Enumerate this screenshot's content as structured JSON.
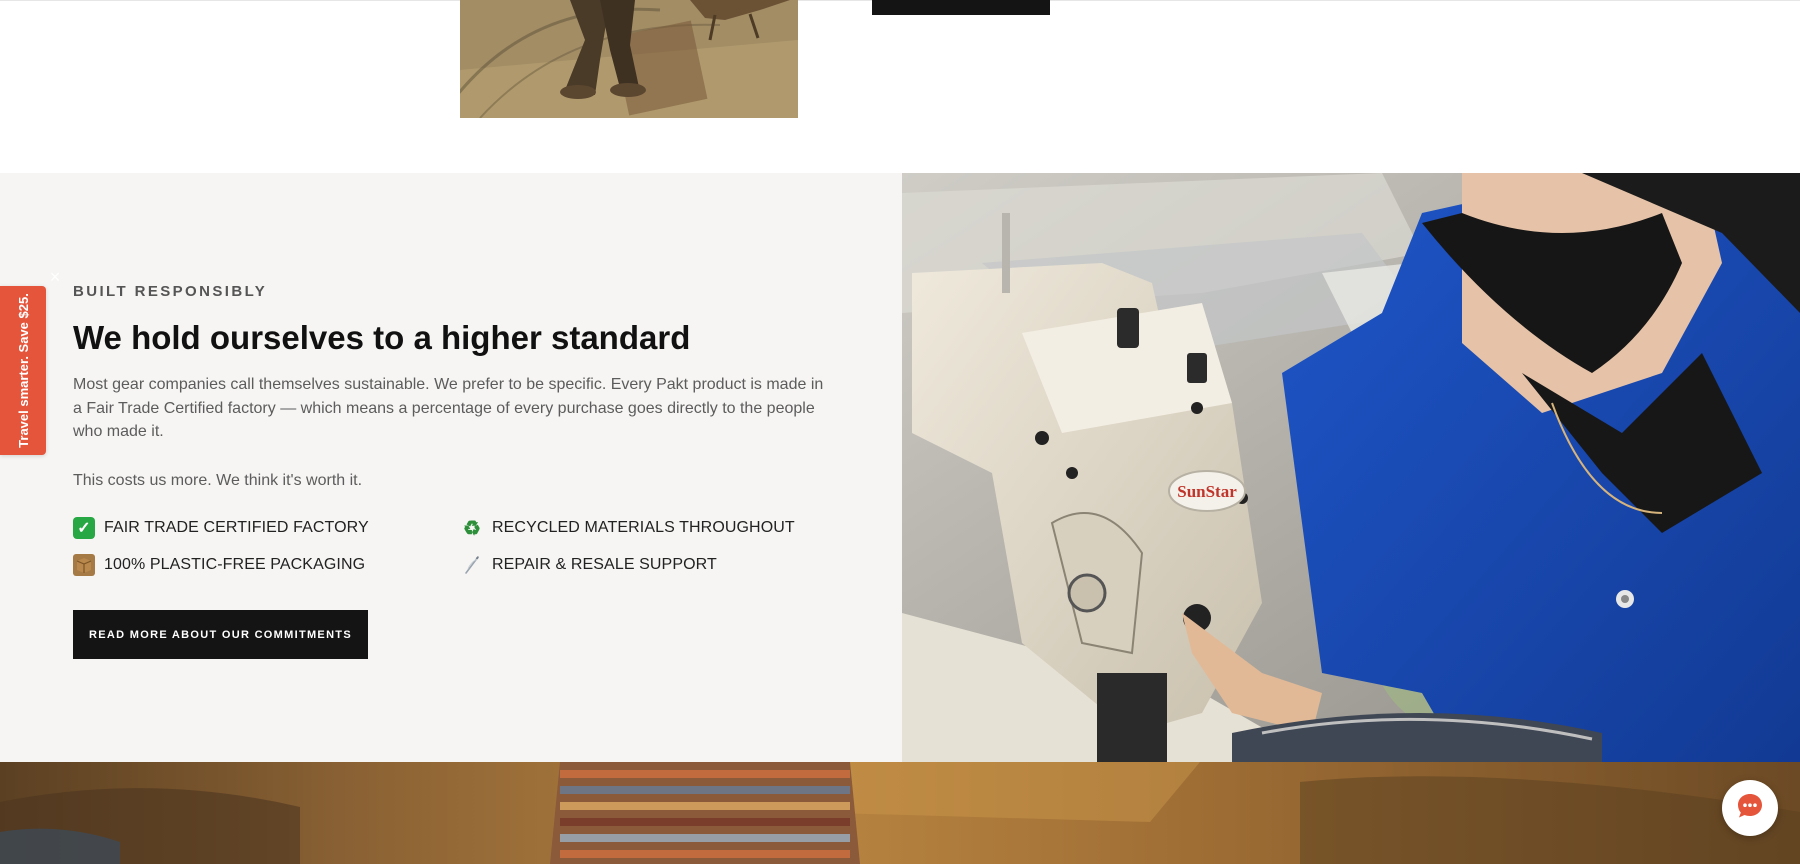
{
  "section": {
    "eyebrow": "BUILT RESPONSIBLY",
    "heading": "We hold ourselves to a higher standard",
    "body": "Most gear companies call themselves sustainable. We prefer to be specific. Every Pakt product is made in a Fair Trade Certified factory — which means a percentage of every purchase goes directly to the people who made it.",
    "body2": "This costs us more. We think it's worth it.",
    "features": [
      {
        "icon": "check-mark-icon",
        "label": "FAIR TRADE CERTIFIED FACTORY"
      },
      {
        "icon": "recycle-icon",
        "label": "RECYCLED MATERIALS THROUGHOUT"
      },
      {
        "icon": "package-icon",
        "label": "100% PLASTIC-FREE PACKAGING"
      },
      {
        "icon": "needle-icon",
        "label": "REPAIR & RESALE SUPPORT"
      }
    ],
    "cta_label": "READ MORE ABOUT OUR COMMITMENTS",
    "image_brand_label": "SunStar"
  },
  "promo": {
    "tab_label": "Travel smarter. Save $25.",
    "close_glyph": "×"
  },
  "colors": {
    "promo_accent": "#e4553b",
    "section_background": "#f6f5f3",
    "cta_background": "#141414"
  }
}
